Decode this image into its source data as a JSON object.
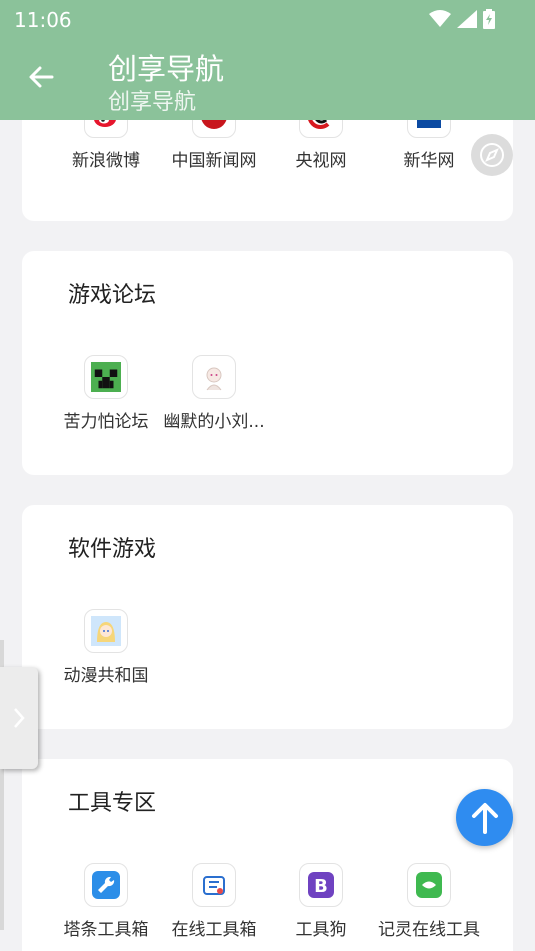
{
  "status": {
    "time": "11:06"
  },
  "appbar": {
    "title": "创享导航",
    "subtitle": "创享导航"
  },
  "sections": [
    {
      "title": "",
      "items": [
        {
          "label": "新浪微博",
          "icon": "weibo-icon"
        },
        {
          "label": "中国新闻网",
          "icon": "chinanews-icon"
        },
        {
          "label": "央视网",
          "icon": "cctv-icon"
        },
        {
          "label": "新华网",
          "icon": "xinhua-icon"
        }
      ]
    },
    {
      "title": "游戏论坛",
      "items": [
        {
          "label": "苦力怕论坛",
          "icon": "creeper-icon"
        },
        {
          "label": "幽默的小刘...",
          "icon": "anime-avatar-icon"
        }
      ]
    },
    {
      "title": "软件游戏",
      "items": [
        {
          "label": "动漫共和国",
          "icon": "anime-girl-icon"
        }
      ]
    },
    {
      "title": "工具专区",
      "items": [
        {
          "label": "塔条工具箱",
          "icon": "wrench-icon"
        },
        {
          "label": "在线工具箱",
          "icon": "toolbox-icon"
        },
        {
          "label": "工具狗",
          "icon": "bootstrap-b-icon"
        },
        {
          "label": "记灵在线工具",
          "icon": "jiling-icon"
        }
      ]
    }
  ],
  "colors": {
    "primary": "#8bc29a",
    "fab": "#2f8cf0",
    "background": "#f2f2f4"
  }
}
